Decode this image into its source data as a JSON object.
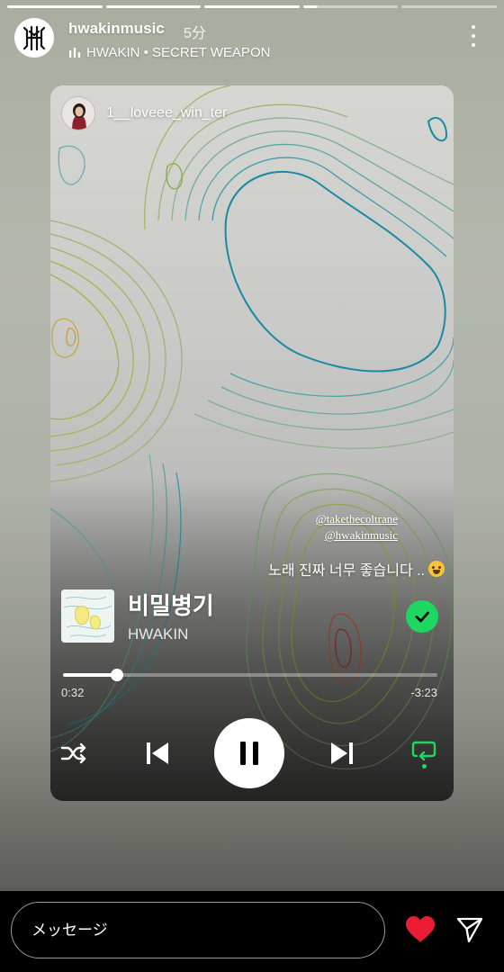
{
  "story": {
    "segments": [
      "done",
      "done",
      "done",
      "partial",
      "empty"
    ],
    "author": {
      "username": "hwakinmusic",
      "time_ago": "5分",
      "avatar_icon": "hwakin-logo-icon"
    },
    "music": {
      "icon": "equalizer-icon",
      "label": "HWAKIN • SECRET WEAPON"
    },
    "more_icon": "more-vertical-icon"
  },
  "shared_post": {
    "sharer": "1__loveee_win_ter",
    "mentions": [
      "@takethecoltrane",
      "@hwakinmusic"
    ],
    "caption": "노래 진짜 너무 좋습니다 ..",
    "caption_emoji": "loudly-crying-face-emoji"
  },
  "player": {
    "song_title": "비밀병기",
    "artist": "HWAKIN",
    "liked": true,
    "elapsed": "0:32",
    "remaining": "-3:23",
    "progress": 0.145,
    "accent_color": "#1ed760",
    "controls": {
      "shuffle_icon": "shuffle-icon",
      "prev_icon": "skip-previous-icon",
      "play_state_icon": "pause-icon",
      "next_icon": "skip-next-icon",
      "repeat_icon": "repeat-icon",
      "repeat_active": true
    }
  },
  "reply_bar": {
    "placeholder": "メッセージ",
    "like_icon": "heart-icon",
    "like_color": "#ed1c35",
    "send_icon": "send-icon"
  }
}
